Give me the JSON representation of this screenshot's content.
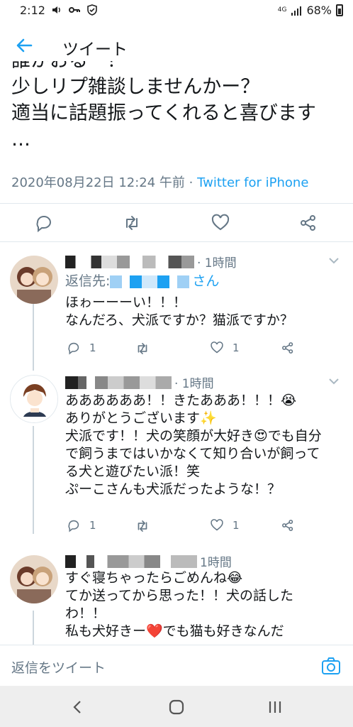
{
  "status_bar": {
    "time": "2:12",
    "network": "4G",
    "battery": "68%"
  },
  "header": {
    "title": "ツイート"
  },
  "tweet": {
    "lines": [
      "誰かおるー？",
      "少しリプ雑談しませんかー？",
      "適当に話題振ってくれると喜びます",
      "…"
    ],
    "timestamp": "2020年08月22日 12:24 午前 · ",
    "source": "Twitter for iPhone"
  },
  "action_bar": {
    "icons": [
      "reply-icon",
      "retweet-icon",
      "like-icon",
      "share-icon"
    ]
  },
  "replies": [
    {
      "time": "· 1時間",
      "reply_to_prefix": "返信先: ",
      "reply_to_suffix": "さん",
      "lines": [
        "ほゎーーーい！！！",
        "なんだろ、犬派ですか？猫派ですか？"
      ],
      "reply_count": "1",
      "like_count": "1"
    },
    {
      "time": "· 1時間",
      "lines": [
        "ああああああ！！きたあああ！！！😭",
        "ありがとうございます✨",
        "犬派です！！犬の笑顔が大好き😍でも自分",
        "で飼うまではいかなくて知り合いが飼って",
        "る犬と遊びたい派！笑",
        "ぷーこさんも犬派だったような！？"
      ],
      "reply_count": "1",
      "like_count": "1"
    },
    {
      "time": "1時間",
      "lines": [
        "すぐ寝ちゃったらごめんね😂",
        "てか送ってから思った！！犬の話した",
        "わ！！",
        "私も犬好きー❤️でも猫も好きなんだ"
      ]
    }
  ],
  "compose": {
    "placeholder": "返信をツイート"
  },
  "nav_bar": {
    "icons": [
      "back-icon",
      "home-icon",
      "recents-icon"
    ]
  },
  "colors": {
    "accent": "#1da1f2",
    "muted": "#657786",
    "text": "#14171a"
  }
}
